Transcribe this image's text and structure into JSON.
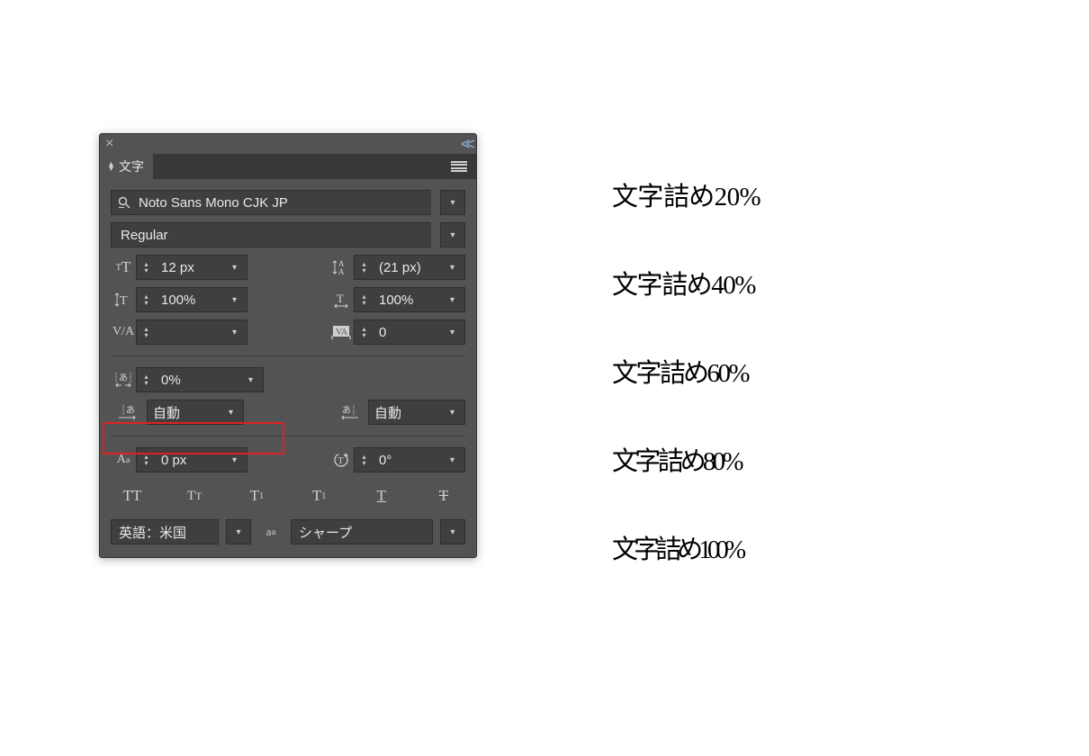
{
  "panel": {
    "tab_label": "文字",
    "font_family": "Noto Sans Mono CJK JP",
    "font_style": "Regular",
    "font_size": "12 px",
    "leading": "(21 px)",
    "vscale": "100%",
    "hscale": "100%",
    "kerning": "",
    "tracking": "0",
    "tsume": "0%",
    "aki_before": "自動",
    "aki_after": "自動",
    "baseline_shift": "0 px",
    "rotation": "0°",
    "language": "英語：米国",
    "antialias": "シャープ"
  },
  "samples": {
    "s20": "文字詰め20%",
    "s40": "文字詰め40%",
    "s60": "文字詰め60%",
    "s80": "文字詰め80%",
    "s100": "文字詰め100%"
  }
}
